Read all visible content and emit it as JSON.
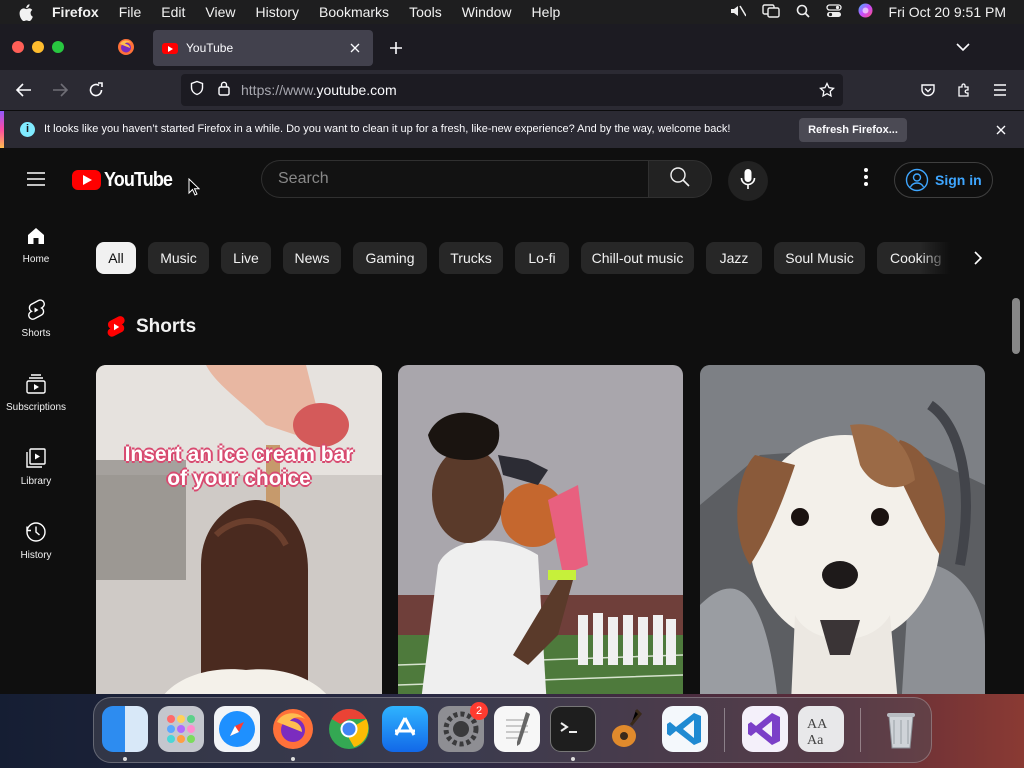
{
  "menubar": {
    "app_name": "Firefox",
    "items": [
      "File",
      "Edit",
      "View",
      "History",
      "Bookmarks",
      "Tools",
      "Window",
      "Help"
    ],
    "clock": "Fri Oct 20  9:51 PM"
  },
  "browser": {
    "tab_title": "YouTube",
    "url_prefix": "https://www.",
    "url_host": "youtube.com",
    "notification_text": "It looks like you haven’t started Firefox in a while. Do you want to clean it up for a fresh, like-new experience? And by the way, welcome back!",
    "notification_button": "Refresh Firefox..."
  },
  "youtube": {
    "logo_text": "YouTube",
    "search_placeholder": "Search",
    "signin_label": "Sign in",
    "sidebar": [
      {
        "label": "Home",
        "icon": "home-icon"
      },
      {
        "label": "Shorts",
        "icon": "shorts-icon"
      },
      {
        "label": "Subscriptions",
        "icon": "subscriptions-icon"
      },
      {
        "label": "Library",
        "icon": "library-icon"
      },
      {
        "label": "History",
        "icon": "history-icon"
      }
    ],
    "chips": [
      "All",
      "Music",
      "Live",
      "News",
      "Gaming",
      "Trucks",
      "Lo-fi",
      "Chill-out music",
      "Jazz",
      "Soul Music",
      "Cooking"
    ],
    "active_chip": "All",
    "shorts_title": "Shorts",
    "shorts": [
      {
        "overlay_line1": "Insert an ice cream bar",
        "overlay_line2": "of your choice"
      },
      {
        "overlay_line1": "",
        "overlay_line2": ""
      },
      {
        "overlay_line1": "",
        "overlay_line2": ""
      }
    ]
  },
  "dock": {
    "apps": [
      "Finder",
      "Launchpad",
      "Safari",
      "Firefox",
      "Chrome",
      "App Store",
      "System Settings",
      "TextEdit",
      "Terminal",
      "GarageBand",
      "Visual Studio Code",
      "Visual Studio",
      "Font Book",
      "Trash"
    ],
    "settings_badge": "2"
  },
  "colors": {
    "yt_red": "#ff0000",
    "link_blue": "#3ea6ff",
    "page_bg": "#0f0f0f"
  }
}
